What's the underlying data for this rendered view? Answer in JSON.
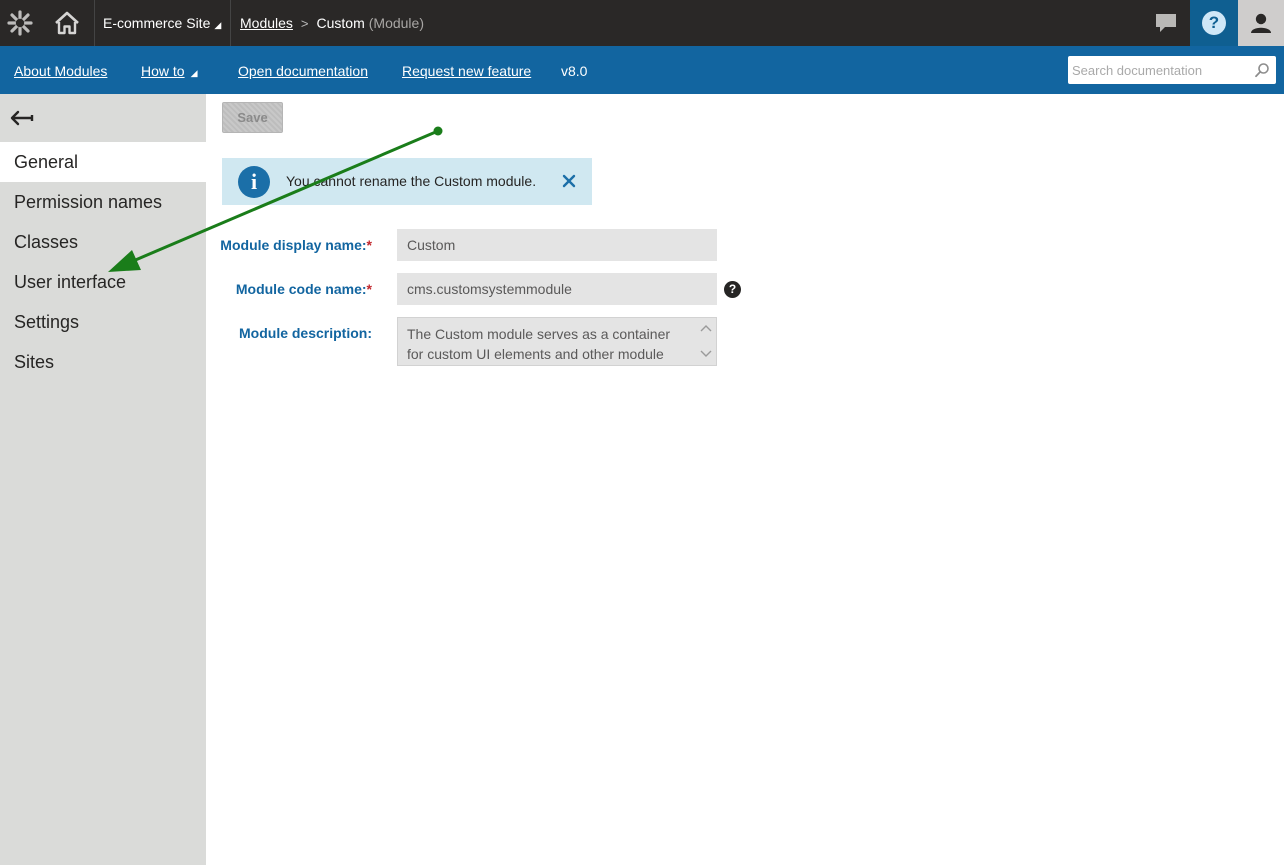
{
  "topbar": {
    "site_name": "E-commerce Site",
    "breadcrumb": {
      "parent": "Modules",
      "current": "Custom",
      "current_suffix": "(Module)"
    },
    "icons": [
      "kentico-logo-icon",
      "home-icon",
      "chat-icon",
      "help-icon",
      "user-icon"
    ]
  },
  "bluebar": {
    "links": [
      "About Modules",
      "How to",
      "Open documentation",
      "Request new feature"
    ],
    "version": "v8.0",
    "search_placeholder": "Search documentation"
  },
  "sidebar": {
    "items": [
      {
        "label": "General",
        "active": true
      },
      {
        "label": "Permission names",
        "active": false
      },
      {
        "label": "Classes",
        "active": false
      },
      {
        "label": "User interface",
        "active": false
      },
      {
        "label": "Settings",
        "active": false
      },
      {
        "label": "Sites",
        "active": false
      }
    ]
  },
  "main": {
    "save_label": "Save",
    "alert_message": "You cannot rename the Custom module.",
    "fields": [
      {
        "label": "Module display name:",
        "required": "*",
        "value": "Custom"
      },
      {
        "label": "Module code name:",
        "required": "*",
        "value": "cms.customsystemmodule"
      },
      {
        "label": "Module description:",
        "value": "The Custom module serves as a container for custom UI elements and other module"
      }
    ],
    "help_mark": "?"
  },
  "colors": {
    "topbar_bg": "#2a2827",
    "bluebar_bg": "#1265a0",
    "sidebar_bg": "#dadbd9",
    "label_blue": "#1265a0",
    "alert_bg": "#d0e8f1",
    "annotation_arrow": "#1a7d1a"
  }
}
